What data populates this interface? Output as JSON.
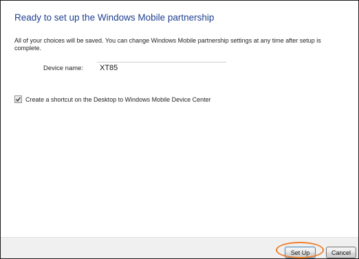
{
  "wizard": {
    "heading": "Ready to set up the Windows Mobile partnership",
    "description": "All of your choices will be saved. You can change Windows Mobile partnership settings at any time after setup is complete.",
    "device_name_label": "Device name:",
    "device_name_value": "XT85",
    "shortcut_checkbox_label": "Create a shortcut on the Desktop to Windows Mobile Device Center",
    "shortcut_checked": true
  },
  "buttons": {
    "setup_label": "Set Up",
    "cancel_label": "Cancel"
  },
  "colors": {
    "heading": "#1e3f8f",
    "highlight": "#ee7f2d"
  }
}
